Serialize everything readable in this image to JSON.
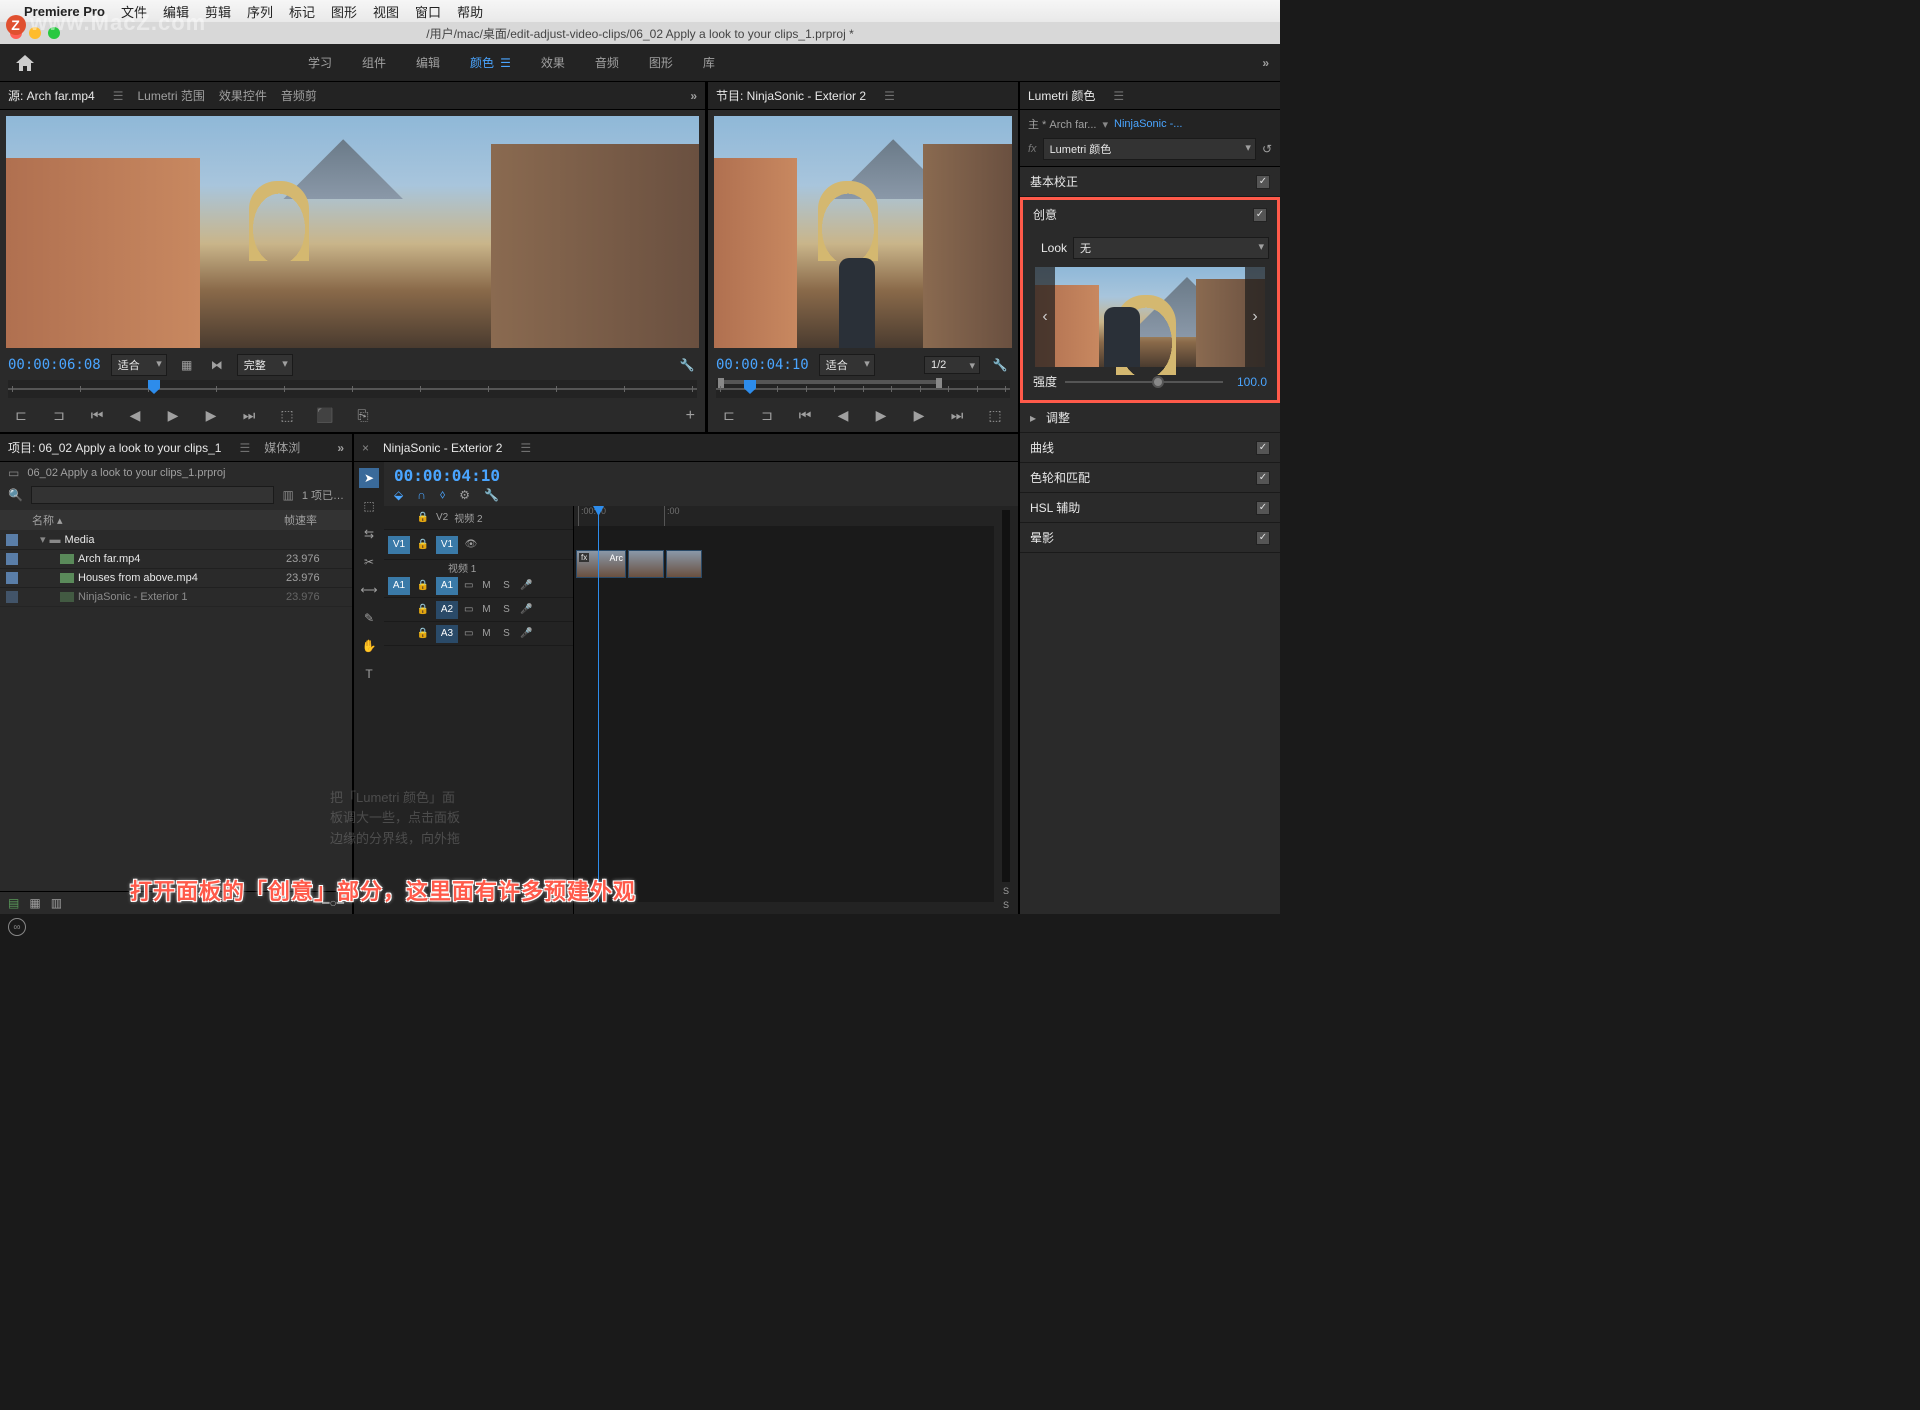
{
  "menubar": {
    "app_name": "Premiere Pro",
    "items": [
      "文件",
      "编辑",
      "剪辑",
      "序列",
      "标记",
      "图形",
      "视图",
      "窗口",
      "帮助"
    ]
  },
  "document_title": "/用户/mac/桌面/edit-adjust-video-clips/06_02 Apply a look to your clips_1.prproj *",
  "workspaces": {
    "items": [
      "学习",
      "组件",
      "编辑",
      "颜色",
      "效果",
      "音频",
      "图形",
      "库"
    ],
    "active_index": 3,
    "overflow": "»"
  },
  "source_panel": {
    "tabs": [
      "源: Arch far.mp4",
      "Lumetri 范围",
      "效果控件",
      "音频剪"
    ],
    "active_tab": 0,
    "overflow": "»",
    "timecode": "00:00:06:08",
    "fit_label": "适合",
    "quality_label": "完整"
  },
  "program_panel": {
    "tabs": [
      "节目: NinjaSonic - Exterior 2"
    ],
    "timecode": "00:00:04:10",
    "fit_label": "适合",
    "quality_label": "1/2"
  },
  "lumetri": {
    "panel_title": "Lumetri 颜色",
    "master_label": "主 * Arch far...",
    "sequence_label": "NinjaSonic -...",
    "effect_name": "Lumetri 颜色",
    "sections": {
      "basic": "基本校正",
      "creative": "创意",
      "adjust": "调整",
      "curves": "曲线",
      "wheels": "色轮和匹配",
      "hsl": "HSL 辅助",
      "vignette": "晕影"
    },
    "look_label": "Look",
    "look_value": "无",
    "intensity_label": "强度",
    "intensity_value": "100.0"
  },
  "project": {
    "tabs": [
      "项目: 06_02 Apply a look to your clips_1",
      "媒体浏"
    ],
    "active_tab": 0,
    "overflow": "»",
    "file_name": "06_02 Apply a look to your clips_1.prproj",
    "item_count": "1 项已…",
    "columns": {
      "name": "名称",
      "fps": "帧速率"
    },
    "rows": [
      {
        "type": "bin",
        "name": "Media",
        "fps": ""
      },
      {
        "type": "clip",
        "name": "Arch far.mp4",
        "fps": "23.976"
      },
      {
        "type": "clip",
        "name": "Houses from above.mp4",
        "fps": "23.976"
      },
      {
        "type": "clip",
        "name": "NinjaSonic - Exterior 1",
        "fps": "23.976"
      }
    ]
  },
  "timeline": {
    "sequence_name": "NinjaSonic - Exterior 2",
    "timecode": "00:00:04:10",
    "ruler": [
      ":00:00",
      ":00"
    ],
    "tracks": {
      "v2_label": "V2",
      "v2_name": "视频 2",
      "v1_label": "V1",
      "v1_name": "视频 1",
      "a1_label": "A1",
      "a2_label": "A2",
      "a3_label": "A3",
      "m": "M",
      "s": "S"
    },
    "clip1_label": "Arc"
  },
  "annotation_text": "打开面板的「创意」部分，这里面有许多预建外观",
  "ghost_text_lines": [
    "把「Lumetri 颜色」面",
    "板调大一些，点击面板",
    "边缘的分界线，向外拖"
  ],
  "watermark_text": "www.MacZ.com"
}
